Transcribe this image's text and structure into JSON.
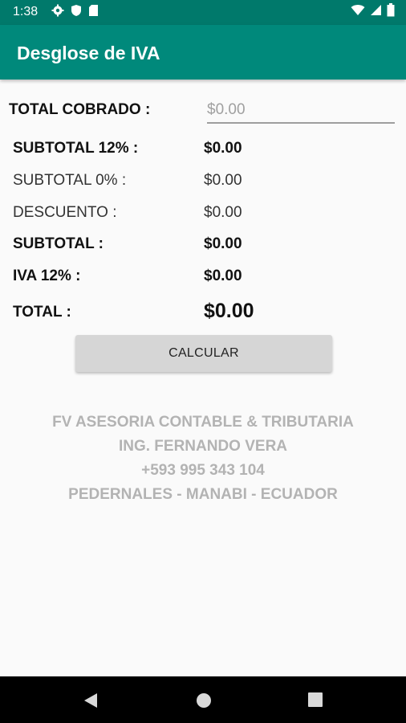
{
  "status_bar": {
    "time": "1:38",
    "left_icons": [
      "gear-icon",
      "shield-icon",
      "sd-card-icon"
    ],
    "right_icons": [
      "wifi-icon",
      "signal-icon",
      "battery-icon"
    ]
  },
  "app_bar": {
    "title": "Desglose de IVA"
  },
  "form": {
    "total_label": "TOTAL COBRADO :",
    "total_placeholder": "$0.00",
    "total_value": ""
  },
  "rows": [
    {
      "label": "SUBTOTAL 12% :",
      "value": "$0.00"
    },
    {
      "label": "SUBTOTAL 0% :",
      "value": "$0.00"
    },
    {
      "label": "DESCUENTO :",
      "value": "$0.00"
    },
    {
      "label": "SUBTOTAL :",
      "value": "$0.00"
    },
    {
      "label": "IVA 12% :",
      "value": "$0.00"
    },
    {
      "label": "TOTAL :",
      "value": "$0.00"
    }
  ],
  "calculate_button": {
    "label": "CALCULAR"
  },
  "footer": {
    "line1": "FV ASESORIA CONTABLE & TRIBUTARIA",
    "line2": "ING. FERNANDO VERA",
    "line3": "+593 995 343 104",
    "line4": "PEDERNALES - MANABI - ECUADOR"
  },
  "colors": {
    "status_bar": "#00796b",
    "app_bar": "#00897b",
    "background": "#fafafa",
    "footer_text": "#b3b3b3",
    "button": "#d6d6d6"
  },
  "nav_bar": {
    "icons": [
      "back-icon",
      "home-icon",
      "recents-icon"
    ]
  }
}
